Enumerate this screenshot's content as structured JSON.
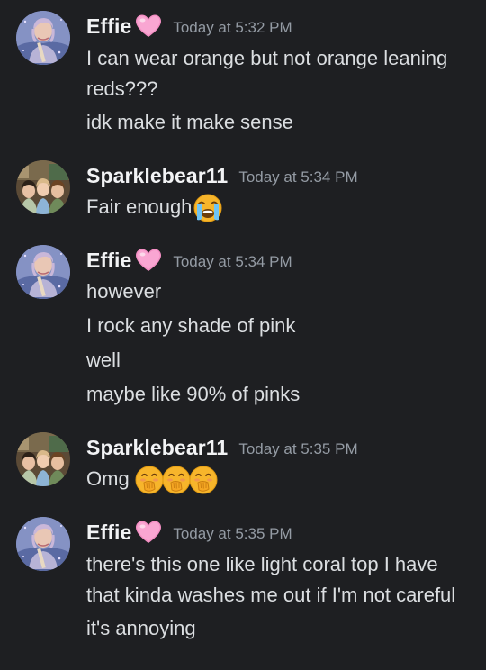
{
  "messages": [
    {
      "username": "Effie",
      "badge_icon": "pink-heart-emoji",
      "timestamp": "Today at 5:32 PM",
      "lines": [
        "I can wear orange but not orange leaning reds???",
        "idk make it make sense"
      ]
    },
    {
      "username": "Sparklebear11",
      "timestamp": "Today at 5:34 PM",
      "lines": [
        "Fair enough"
      ],
      "line_emoji": "loudly-crying-face-emoji"
    },
    {
      "username": "Effie",
      "badge_icon": "pink-heart-emoji",
      "timestamp": "Today at 5:34 PM",
      "lines": [
        "however",
        "I rock any shade of pink",
        "well",
        "maybe like 90% of pinks"
      ]
    },
    {
      "username": "Sparklebear11",
      "timestamp": "Today at 5:35 PM",
      "lines": [
        "Omg"
      ],
      "line_emoji": "face-with-hand-over-mouth-emoji",
      "line_emoji_count": 3
    },
    {
      "username": "Effie",
      "badge_icon": "pink-heart-emoji",
      "timestamp": "Today at 5:35 PM",
      "lines": [
        "there's this one like light coral top I have that kinda washes me out if I'm not careful",
        "it's annoying"
      ]
    }
  ],
  "colors": {
    "background": "#1e1f22",
    "username": "#f2f3f5",
    "message_text": "#dbdee1",
    "timestamp": "#949ba4",
    "heart": "#f78fc5"
  }
}
